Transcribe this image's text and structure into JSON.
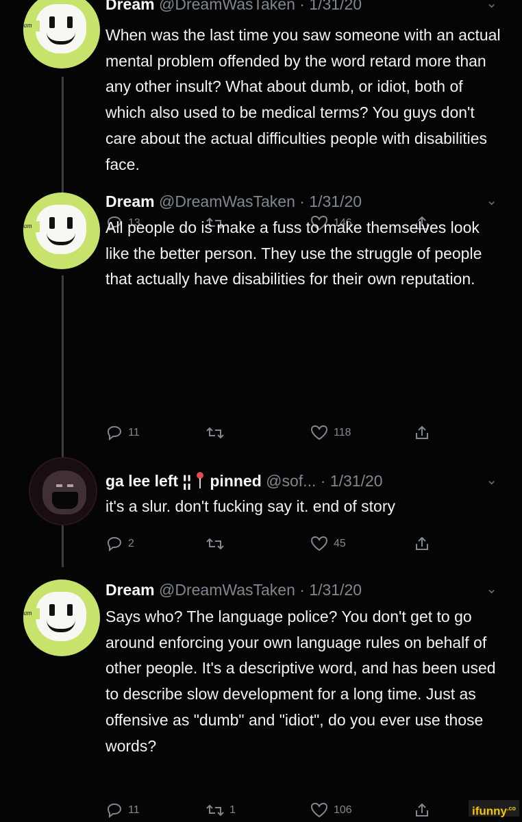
{
  "tweets": [
    {
      "name": "Dream",
      "handle": "@DreamWasTaken",
      "date": "· 1/31/20",
      "avatar_tag": "dream",
      "text": "When was the last time you saw someone with an actual mental problem offended by the word retard more than any other insult? What about dumb, or idiot, both of which also used to be medical terms? You guys don't care about the actual difficulties people with disabilities face.",
      "replies": "13",
      "retweets": "",
      "likes": "146"
    },
    {
      "name": "Dream",
      "handle": "@DreamWasTaken",
      "date": "· 1/31/20",
      "avatar_tag": "dream",
      "text": "All people do is make a fuss to make themselves look like the better person. They use the struggle of people that actually have disabilities for their own reputation.",
      "replies": "11",
      "retweets": "",
      "likes": "118"
    },
    {
      "name_part1": "ga lee left",
      "name_symbols": "¦¦",
      "name_part2": "pinned",
      "handle": "@sof...",
      "date": "· 1/31/20",
      "text": "it's a slur. don't fucking say it. end of story",
      "replies": "2",
      "retweets": "",
      "likes": "45"
    },
    {
      "name": "Dream",
      "handle": "@DreamWasTaken",
      "date": "· 1/31/20",
      "avatar_tag": "dream",
      "text": "Says who? The language police? You don't get to go around enforcing your own language rules on behalf of other people. It's a descriptive word, and has been used to describe slow development for a long time. Just as offensive as \"dumb\" and \"idiot\", do you ever use those words?",
      "replies": "11",
      "retweets": "1",
      "likes": "106"
    }
  ],
  "icons": [
    "reply-icon",
    "retweet-icon",
    "heart-icon",
    "share-icon",
    "chevron-down-icon",
    "pin-icon"
  ],
  "watermark": {
    "brand": "ifunny",
    "suffix": ".co"
  },
  "colors": {
    "background": "#050505",
    "text": "#f2f2f2",
    "meta": "#7f8790",
    "avatar": "#c7e36b",
    "watermark": "#f4c400"
  }
}
